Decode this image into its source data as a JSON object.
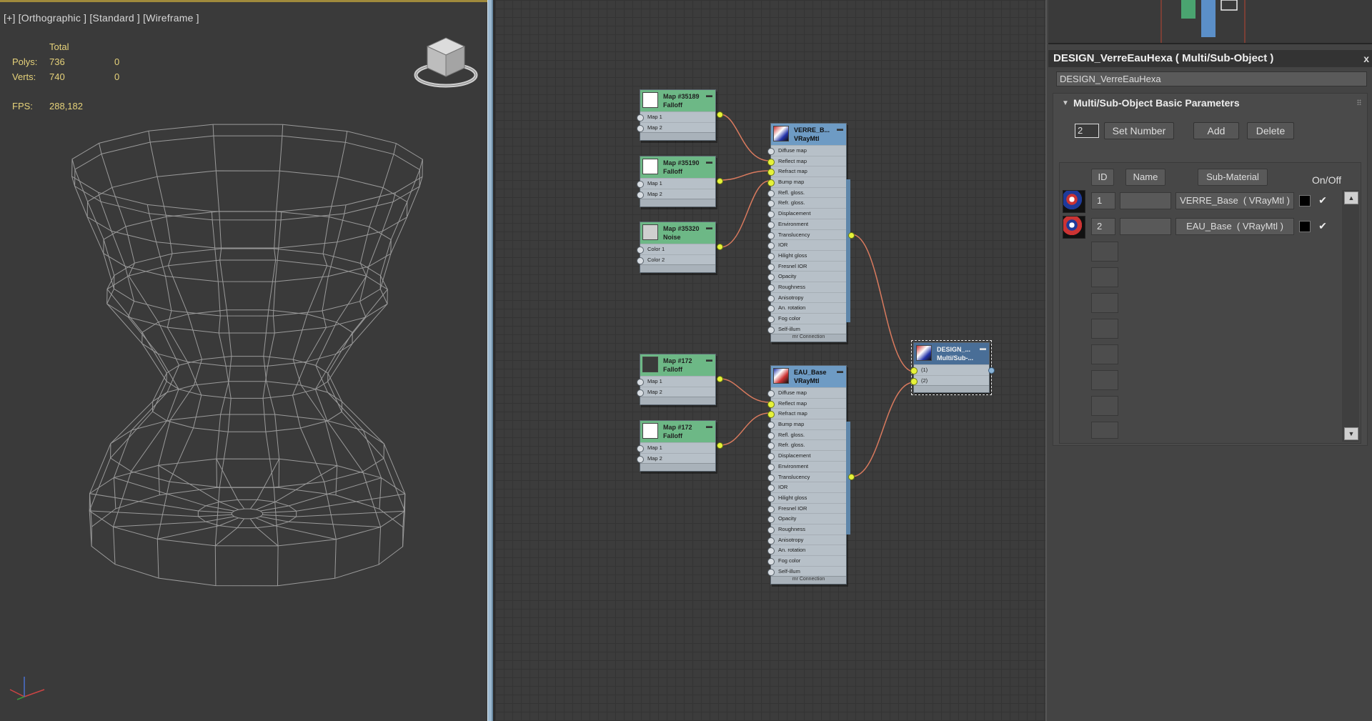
{
  "viewport": {
    "label": "[+] [Orthographic ] [Standard ] [Wireframe ]",
    "stats": {
      "total_label": "Total",
      "polys_label": "Polys:",
      "polys_total": "736",
      "polys_sel": "0",
      "verts_label": "Verts:",
      "verts_total": "740",
      "verts_sel": "0",
      "fps_label": "FPS:",
      "fps_value": "288,182"
    }
  },
  "graph": {
    "maps": [
      {
        "id": "m1",
        "title": "Map #35189",
        "type": "Falloff",
        "slot1": "Map 1",
        "slot2": "Map 2",
        "swatch": "#ffffff"
      },
      {
        "id": "m2",
        "title": "Map #35190",
        "type": "Falloff",
        "slot1": "Map 1",
        "slot2": "Map 2",
        "swatch": "#ffffff"
      },
      {
        "id": "m3",
        "title": "Map #35320",
        "type": "Noise",
        "slot1": "Color 1",
        "slot2": "Color 2",
        "swatch": "#cfcfcf"
      },
      {
        "id": "m4",
        "title": "Map #172",
        "type": "Falloff",
        "slot1": "Map 1",
        "slot2": "Map 2",
        "swatch": "#3a3a3a"
      },
      {
        "id": "m5",
        "title": "Map #172",
        "type": "Falloff",
        "slot1": "Map 1",
        "slot2": "Map 2",
        "swatch": "#ffffff"
      }
    ],
    "materials": [
      {
        "id": "v1",
        "title": "VERRE_B...",
        "type": "VRayMtl"
      },
      {
        "id": "v2",
        "title": "EAU_Base",
        "type": "VRayMtl"
      }
    ],
    "vray_slots": [
      "Diffuse map",
      "Reflect map",
      "Refract map",
      "Bump map",
      "Refl. gloss.",
      "Refr. gloss.",
      "Displacement",
      "Environment",
      "Translucency",
      "IOR",
      "Hilight gloss",
      "Fresnel IOR",
      "Opacity",
      "Roughness",
      "Anisotropy",
      "An. rotation",
      "Fog color",
      "Self-illum"
    ],
    "mtl_footer": "mr Connection",
    "multi": {
      "title": "DESIGN_...",
      "type": "Multi/Sub-...",
      "slot1": "(1)",
      "slot2": "(2)"
    }
  },
  "panel": {
    "title": "DESIGN_VerreEauHexa  ( Multi/Sub-Object )",
    "close": "x",
    "material_name": "DESIGN_VerreEauHexa",
    "rollout_title": "Multi/Sub-Object Basic Parameters",
    "number_value": "2",
    "set_number": "Set Number",
    "add": "Add",
    "delete": "Delete",
    "col_id": "ID",
    "col_name": "Name",
    "col_sub": "Sub-Material",
    "col_onoff": "On/Off",
    "rows": [
      {
        "id": "1",
        "sub": "VERRE_Base  ( VRayMtl )",
        "on": "✔"
      },
      {
        "id": "2",
        "sub": "EAU_Base  ( VRayMtl )",
        "on": "✔"
      }
    ],
    "colors": {
      "accent": "#6db886",
      "mtl_header": "#6e9bc4",
      "socket": "#e6f23a",
      "wire": "#d97a5e"
    }
  }
}
